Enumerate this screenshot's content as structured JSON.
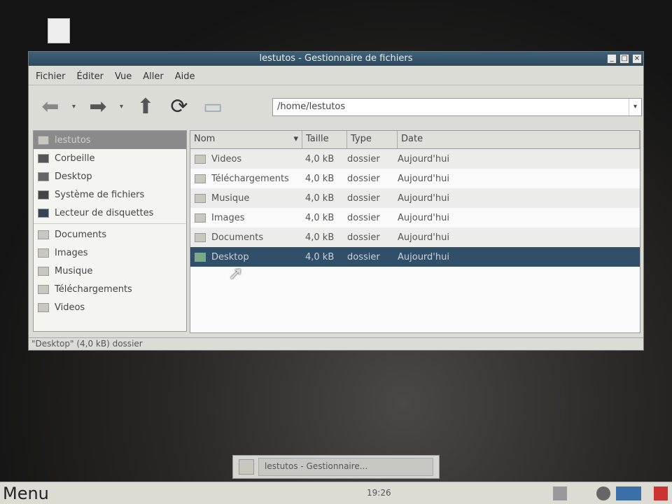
{
  "window": {
    "title": "lestutos - Gestionnaire de fichiers"
  },
  "menu": [
    "Fichier",
    "Éditer",
    "Vue",
    "Aller",
    "Aide"
  ],
  "address": "/home/lestutos",
  "sidebar": {
    "items": [
      {
        "label": "lestutos"
      },
      {
        "label": "Corbeille"
      },
      {
        "label": "Desktop"
      },
      {
        "label": "Système de fichiers"
      },
      {
        "label": "Lecteur de disquettes"
      }
    ],
    "bookmarks": [
      {
        "label": "Documents"
      },
      {
        "label": "Images"
      },
      {
        "label": "Musique"
      },
      {
        "label": "Téléchargements"
      },
      {
        "label": "Videos"
      }
    ]
  },
  "columns": [
    "Nom",
    "Taille",
    "Type",
    "Date"
  ],
  "files": [
    {
      "name": "Videos",
      "size": "4,0 kB",
      "type": "dossier",
      "date": "Aujourd'hui"
    },
    {
      "name": "Téléchargements",
      "size": "4,0 kB",
      "type": "dossier",
      "date": "Aujourd'hui"
    },
    {
      "name": "Musique",
      "size": "4,0 kB",
      "type": "dossier",
      "date": "Aujourd'hui"
    },
    {
      "name": "Images",
      "size": "4,0 kB",
      "type": "dossier",
      "date": "Aujourd'hui"
    },
    {
      "name": "Documents",
      "size": "4,0 kB",
      "type": "dossier",
      "date": "Aujourd'hui"
    },
    {
      "name": "Desktop",
      "size": "4,0 kB",
      "type": "dossier",
      "date": "Aujourd'hui"
    }
  ],
  "status": "\"Desktop\" (4,0 kB) dossier",
  "taskbar": {
    "menu": "Menu",
    "clock": "19:26",
    "task": "lestutos - Gestionnaire..."
  }
}
